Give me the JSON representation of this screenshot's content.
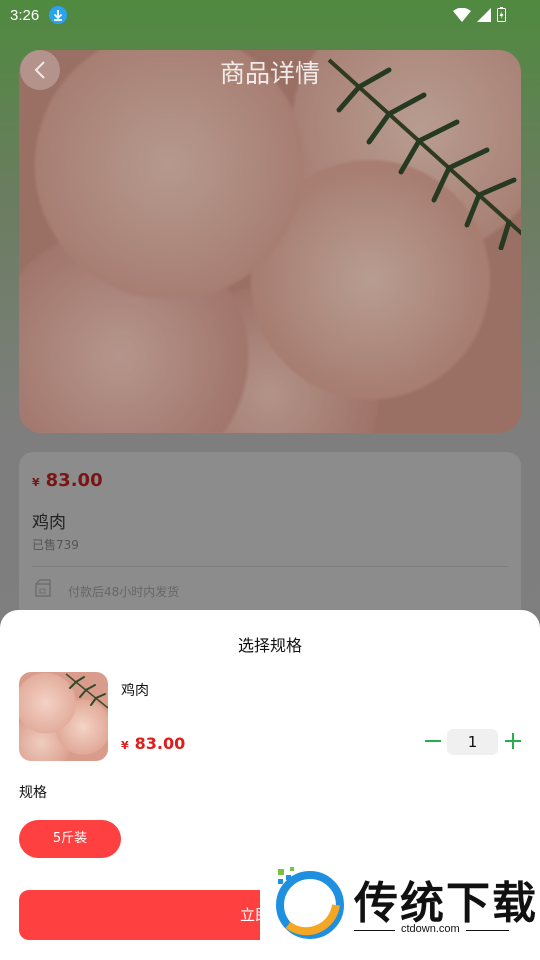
{
  "status_bar": {
    "time": "3:26"
  },
  "page": {
    "title": "商品详情"
  },
  "product_card": {
    "currency": "¥",
    "price": "83.00",
    "name": "鸡肉",
    "sold": "已售739",
    "shipping_note": "付款后48小时内发货"
  },
  "sheet": {
    "title": "选择规格",
    "product_name": "鸡肉",
    "currency": "¥",
    "price": "83.00",
    "quantity": "1",
    "spec_label": "规格",
    "spec_options": [
      "5斤装"
    ],
    "buy_label": "立即购买"
  },
  "watermark": {
    "brand": "传统下载",
    "url": "ctdown.com"
  },
  "colors": {
    "accent": "#ff4040",
    "price": "#e21b1b",
    "stepper": "#22b14c"
  }
}
